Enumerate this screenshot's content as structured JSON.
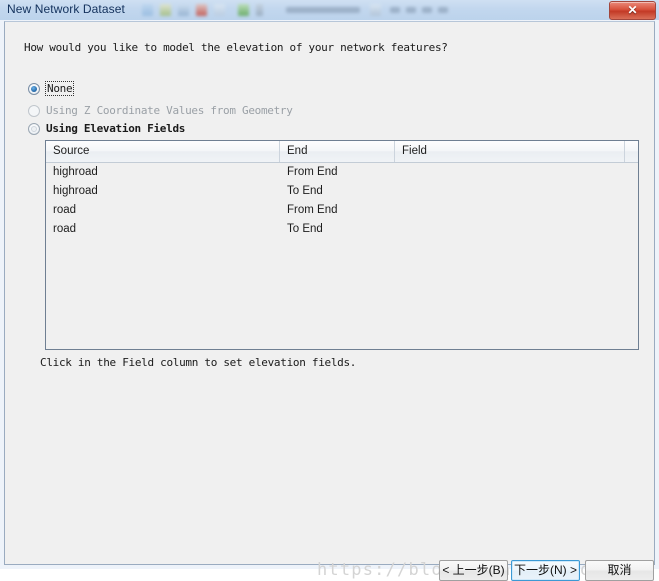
{
  "window": {
    "title": "New Network Dataset",
    "close_label": "✕"
  },
  "dialog": {
    "question": "How would you like to model the elevation of your network features?"
  },
  "elevation_options": [
    {
      "label": "None",
      "selected": true,
      "disabled": false,
      "focused": true
    },
    {
      "label": "Using Z Coordinate Values from Geometry",
      "selected": false,
      "disabled": true,
      "focused": false
    },
    {
      "label": "Using Elevation Fields",
      "selected": false,
      "disabled": false,
      "focused": false
    }
  ],
  "table": {
    "columns": [
      "Source",
      "End",
      "Field",
      ""
    ],
    "rows": [
      {
        "source": "highroad",
        "end": "From End",
        "field": ""
      },
      {
        "source": "highroad",
        "end": "To End",
        "field": ""
      },
      {
        "source": "road",
        "end": "From End",
        "field": ""
      },
      {
        "source": "road",
        "end": "To End",
        "field": ""
      }
    ]
  },
  "hint": "Click in the Field column to set elevation fields.",
  "watermark": "https://blog.csdn.net/fo1997",
  "footer": {
    "back_label": "< 上一步(B)",
    "next_label": "下一步(N) >",
    "cancel_label": "取消"
  }
}
